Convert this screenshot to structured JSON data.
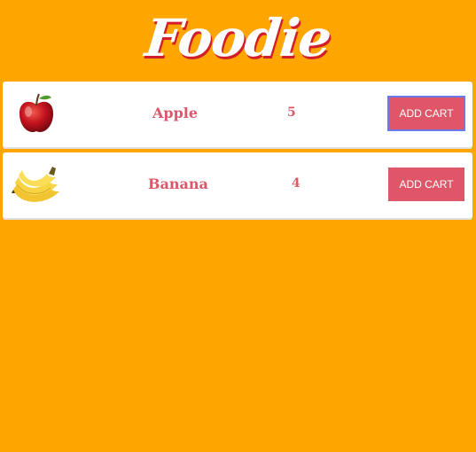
{
  "header": {
    "brand": "Foodie"
  },
  "colors": {
    "background": "#FFA500",
    "accent": "#DE5668",
    "text_accent": "#D9596A",
    "card": "#FFFFFF"
  },
  "products": [
    {
      "name": "Apple",
      "quantity": "5",
      "button_label": "ADD CART",
      "image": "apple-image"
    },
    {
      "name": "Banana",
      "quantity": "4",
      "button_label": "ADD CART",
      "image": "banana-image"
    }
  ]
}
